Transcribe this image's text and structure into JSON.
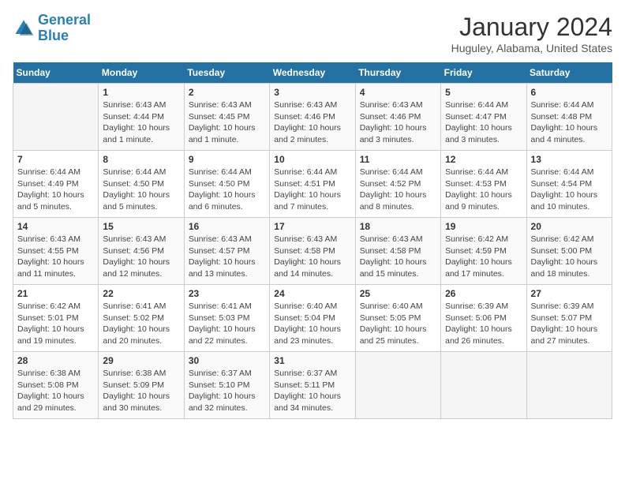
{
  "logo": {
    "text_general": "General",
    "text_blue": "Blue"
  },
  "title": "January 2024",
  "location": "Huguley, Alabama, United States",
  "weekdays": [
    "Sunday",
    "Monday",
    "Tuesday",
    "Wednesday",
    "Thursday",
    "Friday",
    "Saturday"
  ],
  "weeks": [
    [
      {
        "day": "",
        "sunrise": "",
        "sunset": "",
        "daylight": ""
      },
      {
        "day": "1",
        "sunrise": "Sunrise: 6:43 AM",
        "sunset": "Sunset: 4:44 PM",
        "daylight": "Daylight: 10 hours and 1 minute."
      },
      {
        "day": "2",
        "sunrise": "Sunrise: 6:43 AM",
        "sunset": "Sunset: 4:45 PM",
        "daylight": "Daylight: 10 hours and 1 minute."
      },
      {
        "day": "3",
        "sunrise": "Sunrise: 6:43 AM",
        "sunset": "Sunset: 4:46 PM",
        "daylight": "Daylight: 10 hours and 2 minutes."
      },
      {
        "day": "4",
        "sunrise": "Sunrise: 6:43 AM",
        "sunset": "Sunset: 4:46 PM",
        "daylight": "Daylight: 10 hours and 3 minutes."
      },
      {
        "day": "5",
        "sunrise": "Sunrise: 6:44 AM",
        "sunset": "Sunset: 4:47 PM",
        "daylight": "Daylight: 10 hours and 3 minutes."
      },
      {
        "day": "6",
        "sunrise": "Sunrise: 6:44 AM",
        "sunset": "Sunset: 4:48 PM",
        "daylight": "Daylight: 10 hours and 4 minutes."
      }
    ],
    [
      {
        "day": "7",
        "sunrise": "Sunrise: 6:44 AM",
        "sunset": "Sunset: 4:49 PM",
        "daylight": "Daylight: 10 hours and 5 minutes."
      },
      {
        "day": "8",
        "sunrise": "Sunrise: 6:44 AM",
        "sunset": "Sunset: 4:50 PM",
        "daylight": "Daylight: 10 hours and 5 minutes."
      },
      {
        "day": "9",
        "sunrise": "Sunrise: 6:44 AM",
        "sunset": "Sunset: 4:50 PM",
        "daylight": "Daylight: 10 hours and 6 minutes."
      },
      {
        "day": "10",
        "sunrise": "Sunrise: 6:44 AM",
        "sunset": "Sunset: 4:51 PM",
        "daylight": "Daylight: 10 hours and 7 minutes."
      },
      {
        "day": "11",
        "sunrise": "Sunrise: 6:44 AM",
        "sunset": "Sunset: 4:52 PM",
        "daylight": "Daylight: 10 hours and 8 minutes."
      },
      {
        "day": "12",
        "sunrise": "Sunrise: 6:44 AM",
        "sunset": "Sunset: 4:53 PM",
        "daylight": "Daylight: 10 hours and 9 minutes."
      },
      {
        "day": "13",
        "sunrise": "Sunrise: 6:44 AM",
        "sunset": "Sunset: 4:54 PM",
        "daylight": "Daylight: 10 hours and 10 minutes."
      }
    ],
    [
      {
        "day": "14",
        "sunrise": "Sunrise: 6:43 AM",
        "sunset": "Sunset: 4:55 PM",
        "daylight": "Daylight: 10 hours and 11 minutes."
      },
      {
        "day": "15",
        "sunrise": "Sunrise: 6:43 AM",
        "sunset": "Sunset: 4:56 PM",
        "daylight": "Daylight: 10 hours and 12 minutes."
      },
      {
        "day": "16",
        "sunrise": "Sunrise: 6:43 AM",
        "sunset": "Sunset: 4:57 PM",
        "daylight": "Daylight: 10 hours and 13 minutes."
      },
      {
        "day": "17",
        "sunrise": "Sunrise: 6:43 AM",
        "sunset": "Sunset: 4:58 PM",
        "daylight": "Daylight: 10 hours and 14 minutes."
      },
      {
        "day": "18",
        "sunrise": "Sunrise: 6:43 AM",
        "sunset": "Sunset: 4:58 PM",
        "daylight": "Daylight: 10 hours and 15 minutes."
      },
      {
        "day": "19",
        "sunrise": "Sunrise: 6:42 AM",
        "sunset": "Sunset: 4:59 PM",
        "daylight": "Daylight: 10 hours and 17 minutes."
      },
      {
        "day": "20",
        "sunrise": "Sunrise: 6:42 AM",
        "sunset": "Sunset: 5:00 PM",
        "daylight": "Daylight: 10 hours and 18 minutes."
      }
    ],
    [
      {
        "day": "21",
        "sunrise": "Sunrise: 6:42 AM",
        "sunset": "Sunset: 5:01 PM",
        "daylight": "Daylight: 10 hours and 19 minutes."
      },
      {
        "day": "22",
        "sunrise": "Sunrise: 6:41 AM",
        "sunset": "Sunset: 5:02 PM",
        "daylight": "Daylight: 10 hours and 20 minutes."
      },
      {
        "day": "23",
        "sunrise": "Sunrise: 6:41 AM",
        "sunset": "Sunset: 5:03 PM",
        "daylight": "Daylight: 10 hours and 22 minutes."
      },
      {
        "day": "24",
        "sunrise": "Sunrise: 6:40 AM",
        "sunset": "Sunset: 5:04 PM",
        "daylight": "Daylight: 10 hours and 23 minutes."
      },
      {
        "day": "25",
        "sunrise": "Sunrise: 6:40 AM",
        "sunset": "Sunset: 5:05 PM",
        "daylight": "Daylight: 10 hours and 25 minutes."
      },
      {
        "day": "26",
        "sunrise": "Sunrise: 6:39 AM",
        "sunset": "Sunset: 5:06 PM",
        "daylight": "Daylight: 10 hours and 26 minutes."
      },
      {
        "day": "27",
        "sunrise": "Sunrise: 6:39 AM",
        "sunset": "Sunset: 5:07 PM",
        "daylight": "Daylight: 10 hours and 27 minutes."
      }
    ],
    [
      {
        "day": "28",
        "sunrise": "Sunrise: 6:38 AM",
        "sunset": "Sunset: 5:08 PM",
        "daylight": "Daylight: 10 hours and 29 minutes."
      },
      {
        "day": "29",
        "sunrise": "Sunrise: 6:38 AM",
        "sunset": "Sunset: 5:09 PM",
        "daylight": "Daylight: 10 hours and 30 minutes."
      },
      {
        "day": "30",
        "sunrise": "Sunrise: 6:37 AM",
        "sunset": "Sunset: 5:10 PM",
        "daylight": "Daylight: 10 hours and 32 minutes."
      },
      {
        "day": "31",
        "sunrise": "Sunrise: 6:37 AM",
        "sunset": "Sunset: 5:11 PM",
        "daylight": "Daylight: 10 hours and 34 minutes."
      },
      {
        "day": "",
        "sunrise": "",
        "sunset": "",
        "daylight": ""
      },
      {
        "day": "",
        "sunrise": "",
        "sunset": "",
        "daylight": ""
      },
      {
        "day": "",
        "sunrise": "",
        "sunset": "",
        "daylight": ""
      }
    ]
  ]
}
